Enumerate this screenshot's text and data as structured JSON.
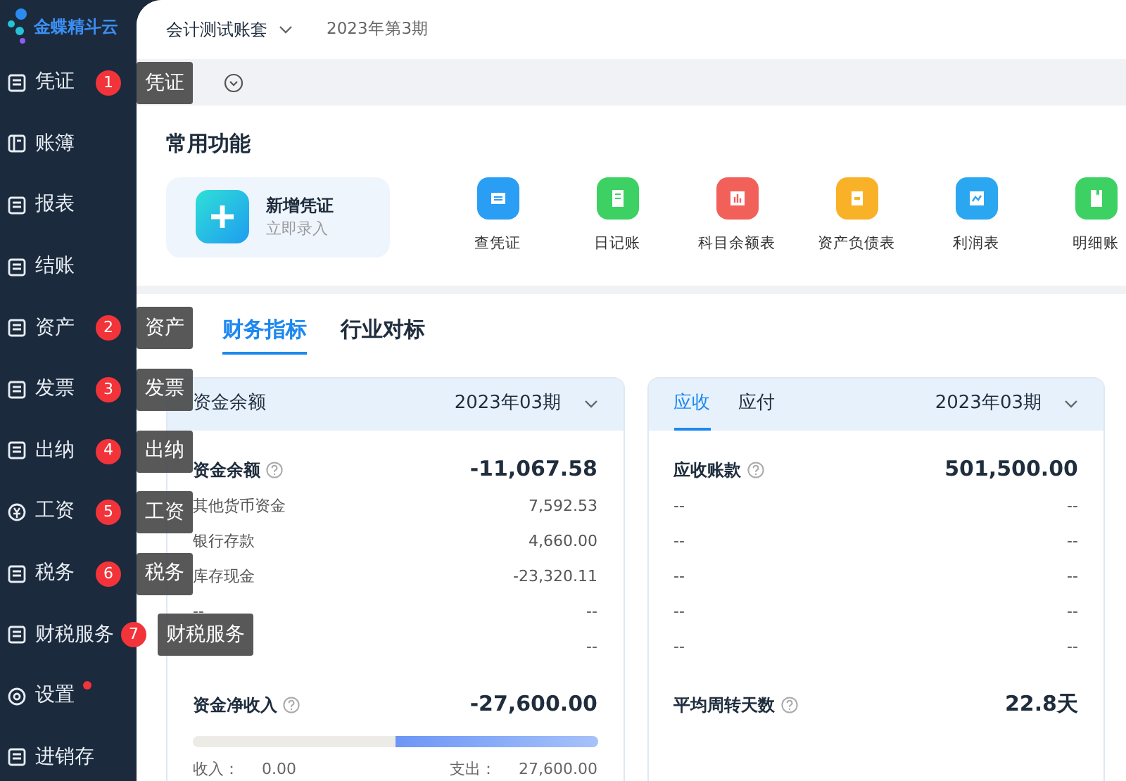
{
  "logo": {
    "text": "金蝶精斗云"
  },
  "topbar": {
    "account": "会计测试账套",
    "period": "2023年第3期"
  },
  "sidebar": {
    "items": [
      {
        "label": "凭证",
        "badge": "1",
        "tooltip": "凭证"
      },
      {
        "label": "账簿"
      },
      {
        "label": "报表"
      },
      {
        "label": "结账"
      },
      {
        "label": "资产",
        "badge": "2",
        "tooltip": "资产"
      },
      {
        "label": "发票",
        "badge": "3",
        "tooltip": "发票"
      },
      {
        "label": "出纳",
        "badge": "4",
        "tooltip": "出纳"
      },
      {
        "label": "工资",
        "badge": "5",
        "tooltip": "工资"
      },
      {
        "label": "税务",
        "badge": "6",
        "tooltip": "税务"
      },
      {
        "label": "财税服务",
        "badge": "7",
        "tooltip": "财税服务"
      },
      {
        "label": "设置",
        "dot": true
      },
      {
        "label": "进销存"
      }
    ]
  },
  "quick": {
    "title": "常用功能",
    "main": {
      "title": "新增凭证",
      "subtitle": "立即录入"
    },
    "items": [
      {
        "label": "查凭证",
        "color": "#2a9df4"
      },
      {
        "label": "日记账",
        "color": "#3dd164"
      },
      {
        "label": "科目余额表",
        "color": "#f2605a"
      },
      {
        "label": "资产负债表",
        "color": "#f9b228"
      },
      {
        "label": "利润表",
        "color": "#2aa7f0"
      },
      {
        "label": "明细账",
        "color": "#3dd164"
      }
    ]
  },
  "tabs": [
    {
      "label": "财务指标",
      "selected": true
    },
    {
      "label": "行业对标",
      "selected": false
    }
  ],
  "cards": [
    {
      "title": "资金余额",
      "period": "2023年03期",
      "main": {
        "label": "资金余额",
        "value": "-11,067.58"
      },
      "rows": [
        {
          "label": "其他货币资金",
          "value": "7,592.53"
        },
        {
          "label": "银行存款",
          "value": "4,660.00"
        },
        {
          "label": "库存现金",
          "value": "-23,320.11"
        },
        {
          "label": "--",
          "value": "--"
        },
        {
          "value": "--"
        }
      ],
      "footer": {
        "label": "资金净收入",
        "value": "-27,600.00",
        "level": 0.5,
        "left_label": "收入：",
        "left_value": "0.00",
        "right_label": "支出：",
        "right_value": "27,600.00"
      }
    },
    {
      "tabs": [
        {
          "label": "应收",
          "selected": true
        },
        {
          "label": "应付",
          "selected": false
        }
      ],
      "period": "2023年03期",
      "main": {
        "label": "应收账款",
        "value": "501,500.00"
      },
      "rows": [
        {
          "label": "--",
          "value": "--"
        },
        {
          "label": "--",
          "value": "--"
        },
        {
          "label": "--",
          "value": "--"
        },
        {
          "label": "--",
          "value": "--"
        },
        {
          "label": "--",
          "value": "--"
        }
      ],
      "footer": {
        "label": "平均周转天数",
        "value": "22.8天"
      }
    }
  ]
}
